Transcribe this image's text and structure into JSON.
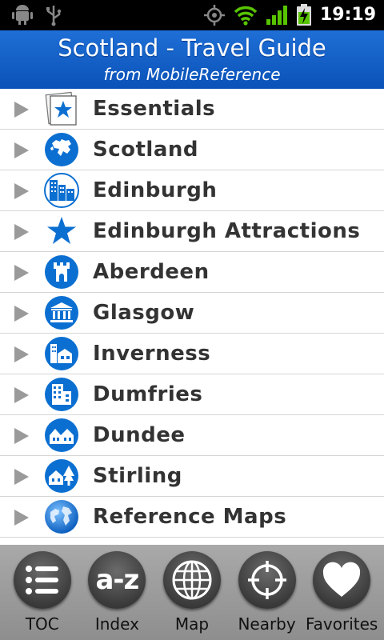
{
  "status_bar": {
    "time": "19:19"
  },
  "header": {
    "title": "Scotland - Travel Guide",
    "subtitle": "from MobileReference"
  },
  "toc_items": [
    {
      "label": "Essentials",
      "icon": "essentials-icon"
    },
    {
      "label": "Scotland",
      "icon": "europe-map-icon"
    },
    {
      "label": "Edinburgh",
      "icon": "city-buildings-icon"
    },
    {
      "label": "Edinburgh Attractions",
      "icon": "star-icon"
    },
    {
      "label": "Aberdeen",
      "icon": "castle-tower-icon"
    },
    {
      "label": "Glasgow",
      "icon": "museum-icon"
    },
    {
      "label": "Inverness",
      "icon": "town-icon"
    },
    {
      "label": "Dumfries",
      "icon": "building-icon"
    },
    {
      "label": "Dundee",
      "icon": "houses-icon"
    },
    {
      "label": "Stirling",
      "icon": "house-tree-icon"
    },
    {
      "label": "Reference Maps",
      "icon": "globe-icon"
    }
  ],
  "toolbar": {
    "toc": "TOC",
    "index": "Index",
    "index_glyph": "a-z",
    "map": "Map",
    "nearby": "Nearby",
    "favorites": "Favorites"
  },
  "colors": {
    "header_blue": "#0a52b8",
    "icon_blue": "#0b6fd1"
  }
}
